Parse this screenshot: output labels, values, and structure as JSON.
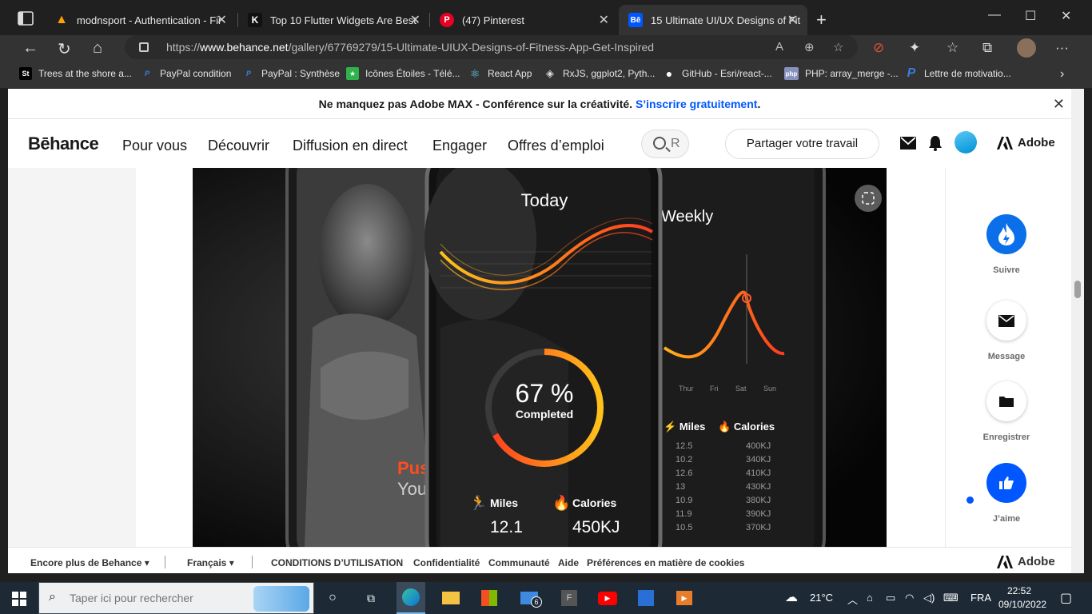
{
  "browser": {
    "tabs": [
      {
        "title": "modnsport - Authentication - Fir",
        "favicon": "firebase-icon"
      },
      {
        "title": "Top 10 Flutter Widgets Are Best",
        "favicon": "k-icon"
      },
      {
        "title": "(47) Pinterest",
        "favicon": "pinterest-icon"
      },
      {
        "title": "15 Ultimate UI/UX Designs of Fit",
        "favicon": "behance-icon"
      }
    ],
    "favicon_behance": "Bē",
    "url_prefix": "https://",
    "url_host": "www.behance.net",
    "url_path": "/gallery/67769279/15-Ultimate-UIUX-Designs-of-Fitness-App-Get-Inspired",
    "bookmarks": [
      {
        "label": "Trees at the shore a...",
        "icon": "St"
      },
      {
        "label": "PayPal condition",
        "icon": "P"
      },
      {
        "label": "PayPal : Synthèse",
        "icon": "P"
      },
      {
        "label": "Icônes Étoiles - Télé...",
        "icon": "★"
      },
      {
        "label": "React App",
        "icon": "⚛"
      },
      {
        "label": "RxJS, ggplot2, Pyth...",
        "icon": "◈"
      },
      {
        "label": "GitHub - Esri/react-...",
        "icon": "●"
      },
      {
        "label": "PHP: array_merge -...",
        "icon": "php"
      },
      {
        "label": "Lettre de motivatio...",
        "icon": "P"
      }
    ]
  },
  "banner": {
    "text": "Ne manquez pas Adobe MAX - Conférence sur la créativité.",
    "link": "S’inscrire gratuitement",
    "period": "."
  },
  "header": {
    "logo": "Bēhance",
    "nav": [
      "Pour vous",
      "Découvrir",
      "Diffusion en direct",
      "Engager",
      "Offres d’emploi"
    ],
    "search_placeholder": "R",
    "share_button": "Partager votre travail",
    "adobe": "Adobe"
  },
  "artwork": {
    "left_text_1": "Pus",
    "left_text_2": "You",
    "center_title": "Today",
    "percent": "67 %",
    "completed": "Completed",
    "completion_fraction": 0.67,
    "miles_label": "Miles",
    "miles_value": "12.1",
    "calories_label": "Calories",
    "calories_value": "450KJ",
    "right_title": "Weekly",
    "days": [
      "Thur",
      "Fri",
      "Sat",
      "Sun"
    ],
    "right_miles_label": "Miles",
    "right_calories_label": "Calories",
    "rows": [
      {
        "miles": "12.5",
        "cal": "400KJ"
      },
      {
        "miles": "10.2",
        "cal": "340KJ"
      },
      {
        "miles": "12.6",
        "cal": "410KJ"
      },
      {
        "miles": "13",
        "cal": "430KJ"
      },
      {
        "miles": "10.9",
        "cal": "380KJ"
      },
      {
        "miles": "11.9",
        "cal": "390KJ"
      },
      {
        "miles": "10.5",
        "cal": "370KJ"
      }
    ]
  },
  "sidebar": {
    "actions": [
      {
        "label": "Suivre"
      },
      {
        "label": "Message"
      },
      {
        "label": "Enregistrer"
      },
      {
        "label": "J’aime"
      }
    ]
  },
  "footer": {
    "more": "Encore plus de Behance",
    "lang": "Français",
    "links": [
      "CONDITIONS D’UTILISATION",
      "Confidentialité",
      "Communauté",
      "Aide",
      "Préférences en matière de cookies"
    ],
    "adobe": "Adobe"
  },
  "taskbar": {
    "search_placeholder": "Taper ici pour rechercher",
    "weather": "21°C",
    "lang": "FRA",
    "time": "22:52",
    "date": "09/10/2022",
    "mail_badge": "6"
  },
  "colors": {
    "behance_blue": "#0057ff",
    "ring_orange": "#ff5a1f",
    "ring_yellow": "#ffc21a"
  }
}
